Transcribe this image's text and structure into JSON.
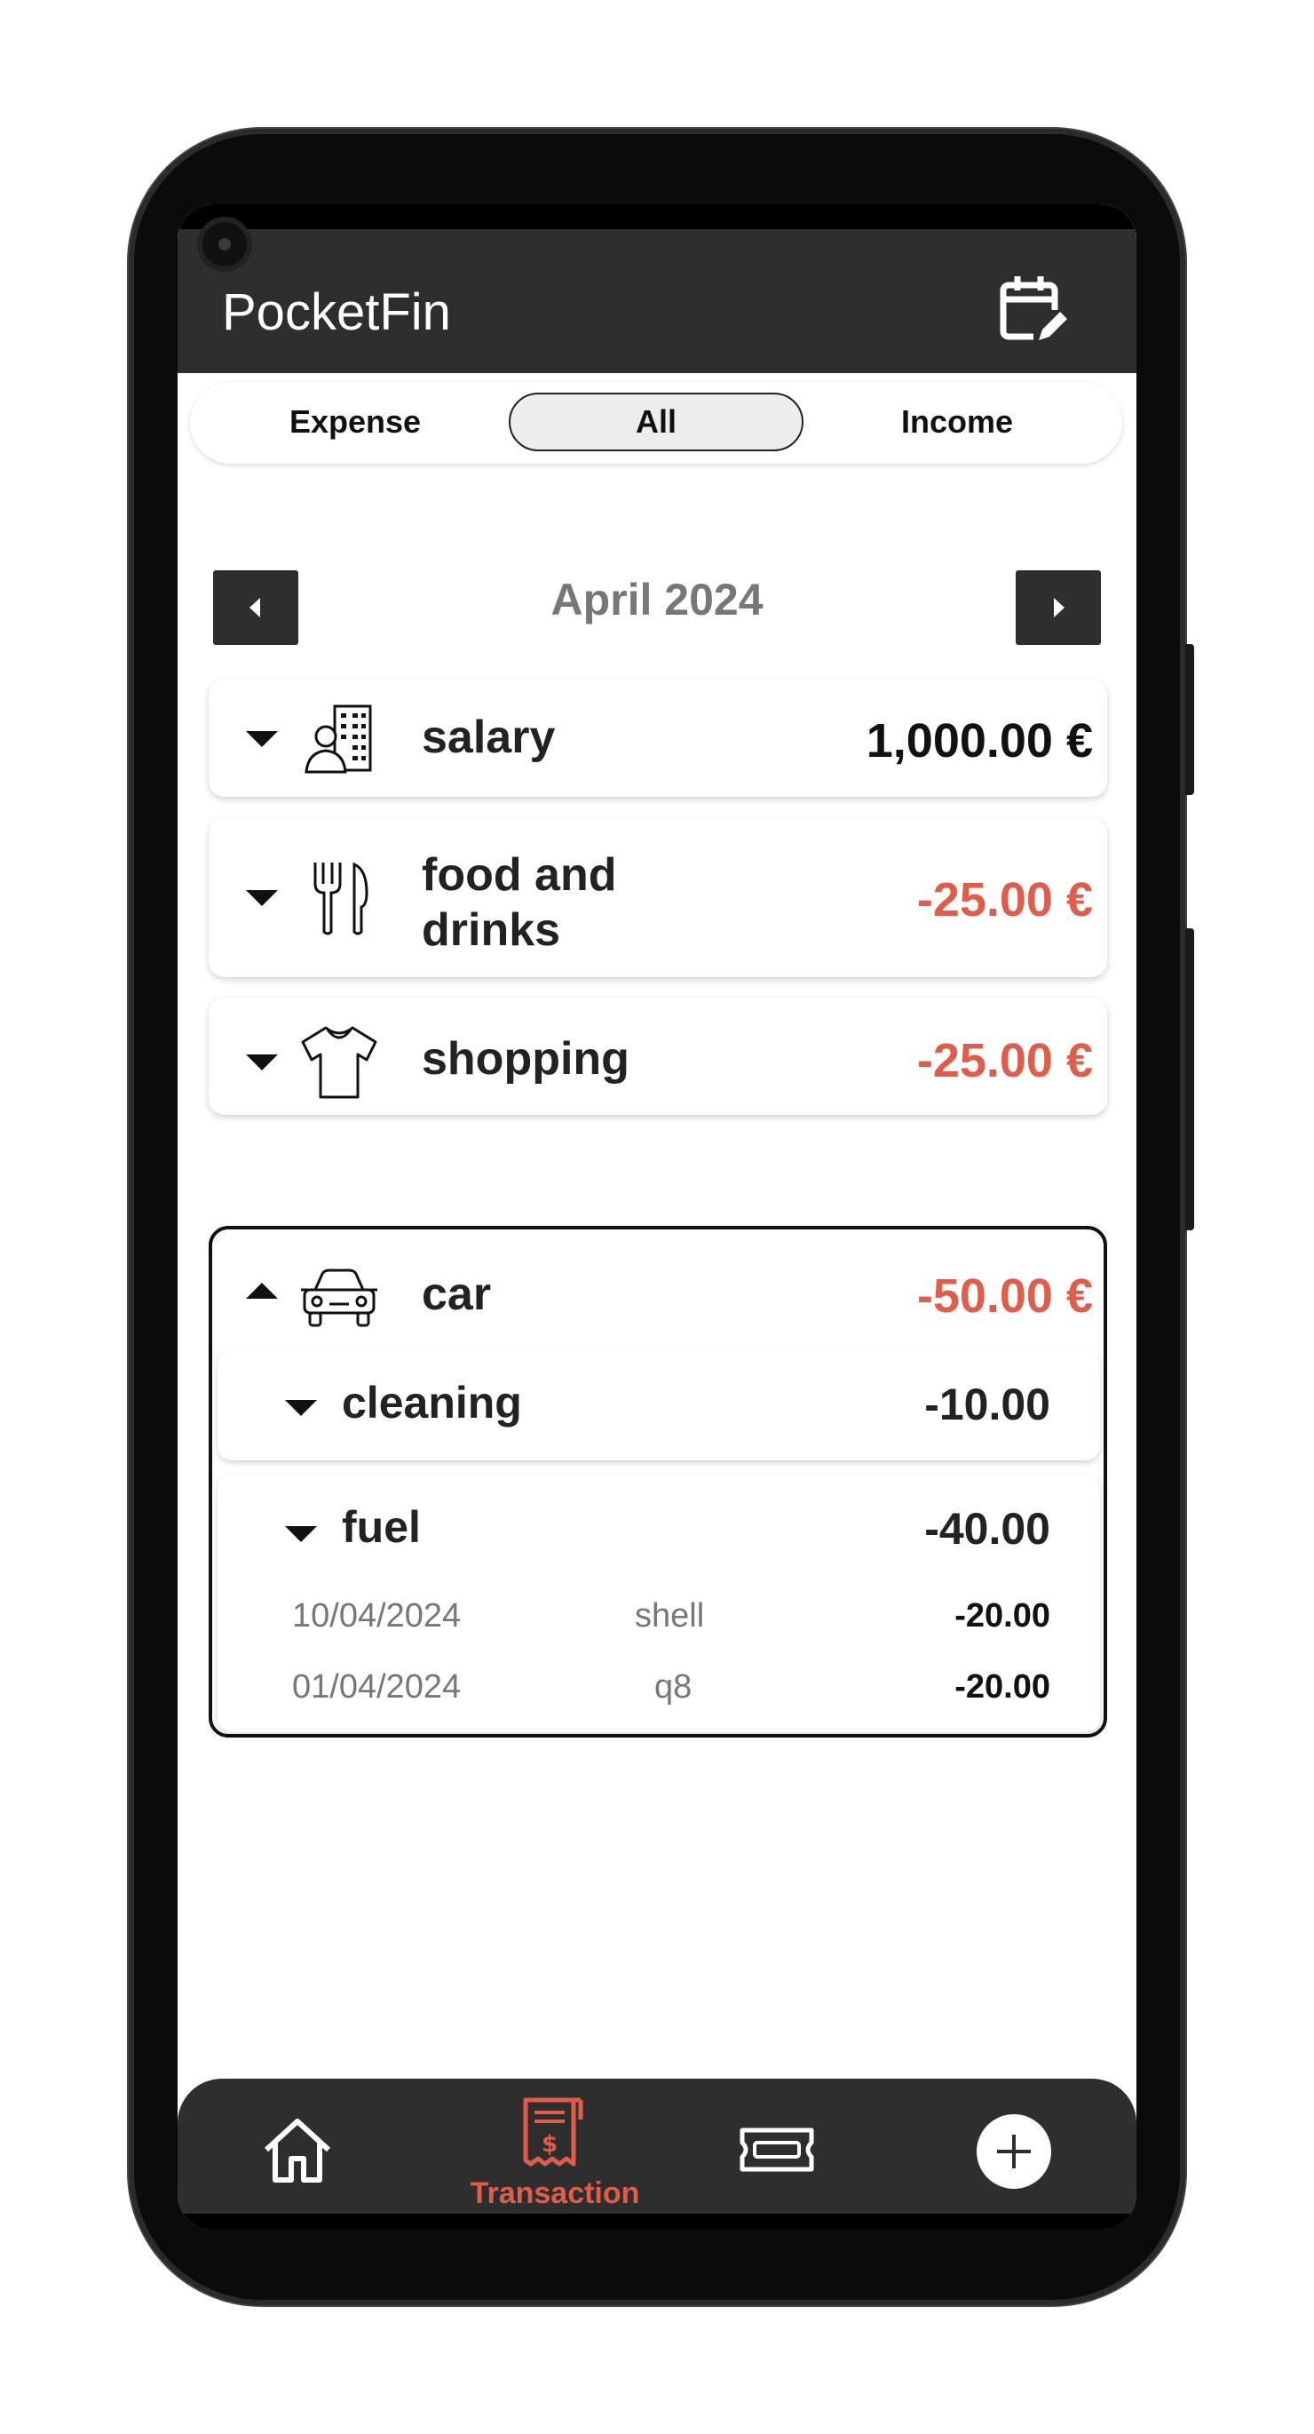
{
  "app": {
    "title": "PocketFin"
  },
  "segments": [
    {
      "label": "Expense",
      "active": false
    },
    {
      "label": "All",
      "active": true
    },
    {
      "label": "Income",
      "active": false
    }
  ],
  "period": {
    "label": "April 2024"
  },
  "categories": [
    {
      "name": "salary",
      "amount": "1,000.00 €",
      "icon": "salary-building-icon",
      "expanded": false
    },
    {
      "name": "food and\ndrinks",
      "amount": "-25.00 €",
      "icon": "fork-knife-icon",
      "expanded": false
    },
    {
      "name": "shopping",
      "amount": "-25.00 €",
      "icon": "tshirt-icon",
      "expanded": false
    },
    {
      "name": "car",
      "amount": "-50.00 €",
      "icon": "car-icon",
      "expanded": true,
      "subcategories": [
        {
          "name": "cleaning",
          "amount": "-10.00",
          "expanded": false
        },
        {
          "name": "fuel",
          "amount": "-40.00",
          "expanded": true,
          "transactions": [
            {
              "date": "10/04/2024",
              "description": "shell",
              "amount": "-20.00"
            },
            {
              "date": "01/04/2024",
              "description": "q8",
              "amount": "-20.00"
            }
          ]
        }
      ]
    }
  ],
  "bottom_nav": {
    "active_label": "Transaction",
    "items": [
      "home-icon",
      "transaction-receipt-icon",
      "ticket-icon",
      "add-icon"
    ]
  },
  "colors": {
    "negative": "#e05d4c",
    "bar": "#2e2e2e"
  }
}
